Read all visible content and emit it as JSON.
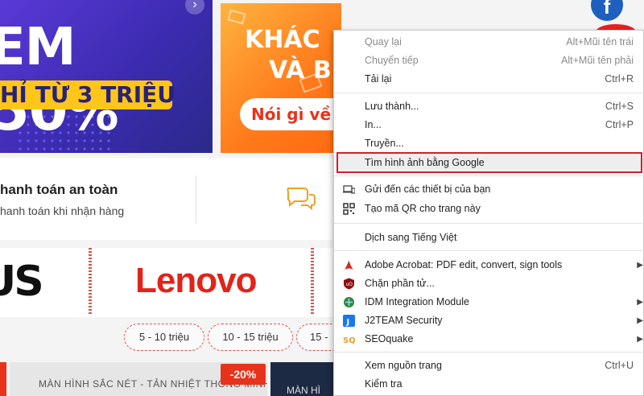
{
  "banner_left": {
    "top_text": "...0%",
    "main_prefix": "EM",
    "main_value": "50",
    "main_suffix": "%",
    "strip_text": "HỈ TỪ 3 TRIỆU",
    "arrow": "›"
  },
  "banner_mid": {
    "line1": "KHÁC",
    "line2": "VÀ B",
    "pill": "Nói gì về"
  },
  "social": {
    "facebook": "f"
  },
  "info": {
    "title": "hanh toán an toàn",
    "subtitle": "hanh toán khi nhận hàng"
  },
  "brands": {
    "asus": "US",
    "lenovo": "Lenovo"
  },
  "price_filters": [
    "5 - 10 triệu",
    "10 - 15 triệu",
    "15 -"
  ],
  "products": {
    "banner1_text": "MÀN HÌNH SẮC NÉT - TẢN NHIỆT THÔNG MINH",
    "discount": "-20%",
    "banner2_text": "MÀN HÌ"
  },
  "context_menu": {
    "items": [
      {
        "label": "Quay lại",
        "shortcut": "Alt+Mũi tên trái",
        "disabled": true
      },
      {
        "label": "Chuyển tiếp",
        "shortcut": "Alt+Mũi tên phải",
        "disabled": true
      },
      {
        "label": "Tải lại",
        "shortcut": "Ctrl+R",
        "disabled": false
      },
      {
        "label": "Lưu thành...",
        "shortcut": "Ctrl+S",
        "disabled": false
      },
      {
        "label": "In...",
        "shortcut": "Ctrl+P",
        "disabled": false
      },
      {
        "label": "Truyền...",
        "shortcut": "",
        "disabled": false
      },
      {
        "label": "Tìm hình ảnh bằng Google",
        "shortcut": "",
        "disabled": false,
        "highlighted": true
      },
      {
        "label": "Gửi đến các thiết bị của bạn",
        "shortcut": "",
        "disabled": false,
        "icon": "devices-icon"
      },
      {
        "label": "Tạo mã QR cho trang này",
        "shortcut": "",
        "disabled": false,
        "icon": "qr-code-icon"
      },
      {
        "label": "Dịch sang Tiếng Việt",
        "shortcut": "",
        "disabled": false
      },
      {
        "label": "Adobe Acrobat: PDF edit, convert, sign tools",
        "shortcut": "",
        "disabled": false,
        "icon": "adobe-acrobat-icon",
        "submenu": true
      },
      {
        "label": "Chặn phần tử...",
        "shortcut": "",
        "disabled": false,
        "icon": "ublock-icon"
      },
      {
        "label": "IDM Integration Module",
        "shortcut": "",
        "disabled": false,
        "icon": "idm-icon",
        "submenu": true
      },
      {
        "label": "J2TEAM Security",
        "shortcut": "",
        "disabled": false,
        "icon": "j2team-icon",
        "submenu": true
      },
      {
        "label": "SEOquake",
        "shortcut": "",
        "disabled": false,
        "icon": "seoquake-icon",
        "submenu": true
      },
      {
        "label": "Xem nguồn trang",
        "shortcut": "Ctrl+U",
        "disabled": false
      },
      {
        "label": "Kiểm tra",
        "shortcut": "",
        "disabled": false
      }
    ],
    "submenu_arrow": "▶"
  },
  "colors": {
    "highlight_border": "#d61f26",
    "lenovo_red": "#e2231a",
    "banner_orange": "#ff7a1a",
    "banner_purple": "#3b2bb0"
  }
}
